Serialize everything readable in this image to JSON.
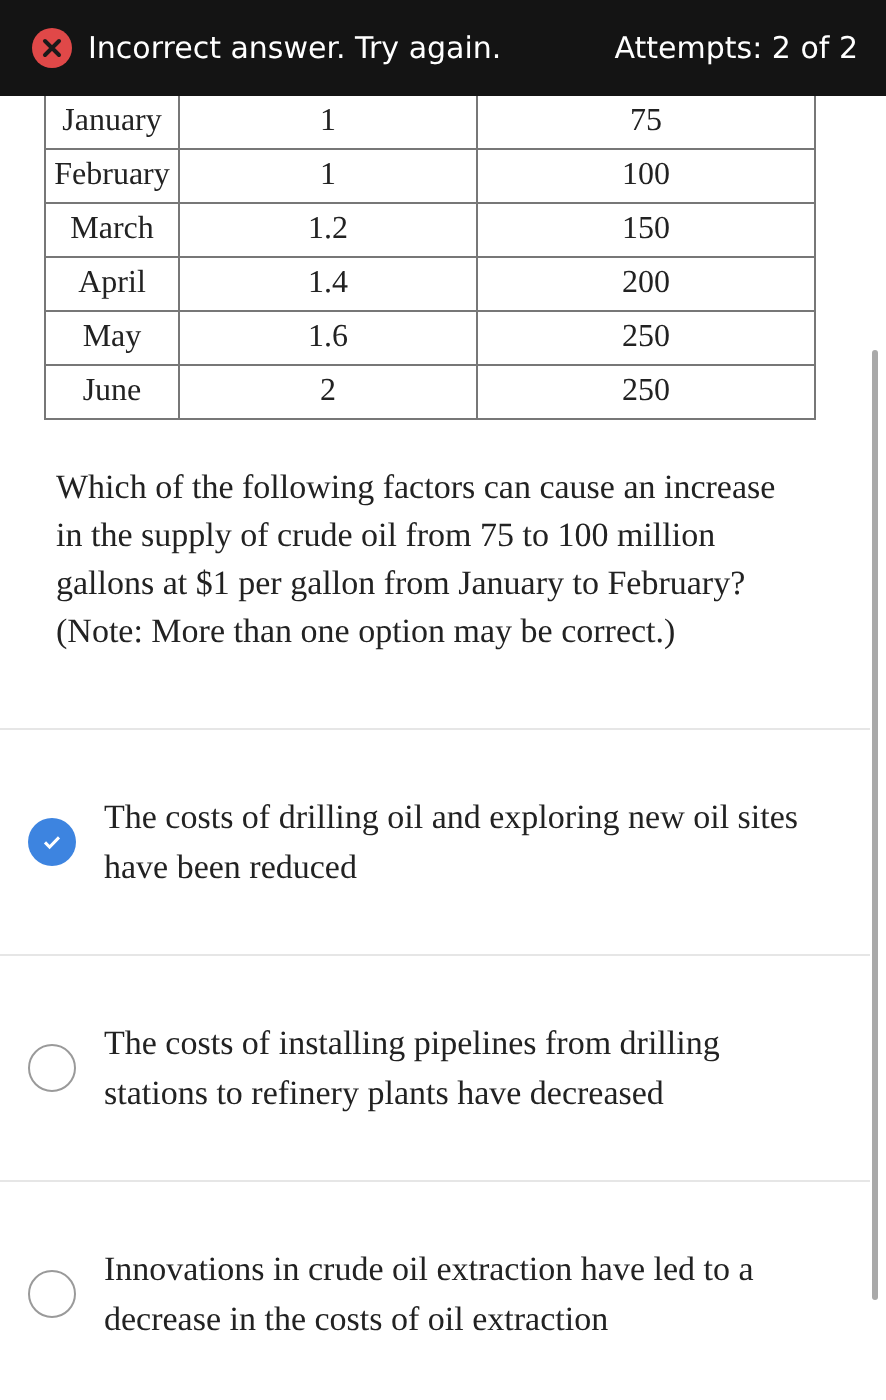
{
  "banner": {
    "error": true,
    "message": "Incorrect answer. Try again.",
    "attempts": "Attempts: 2 of 2"
  },
  "table": {
    "rows": [
      [
        "January",
        "1",
        "75"
      ],
      [
        "February",
        "1",
        "100"
      ],
      [
        "March",
        "1.2",
        "150"
      ],
      [
        "April",
        "1.4",
        "200"
      ],
      [
        "May",
        "1.6",
        "250"
      ],
      [
        "June",
        "2",
        "250"
      ]
    ]
  },
  "question": "Which of the following factors can cause an increase in the supply of crude oil from 75 to 100 million gallons at $1 per gallon from January to February? (Note: More than one option may be correct.)",
  "options": [
    {
      "text": "The costs of drilling oil and exploring new oil sites have been reduced",
      "selected": true
    },
    {
      "text": "The costs of installing pipelines from drilling stations to refinery plants have decreased",
      "selected": false
    },
    {
      "text": "Innovations in crude oil extraction have led to a decrease in the costs of oil extraction",
      "selected": false
    }
  ]
}
